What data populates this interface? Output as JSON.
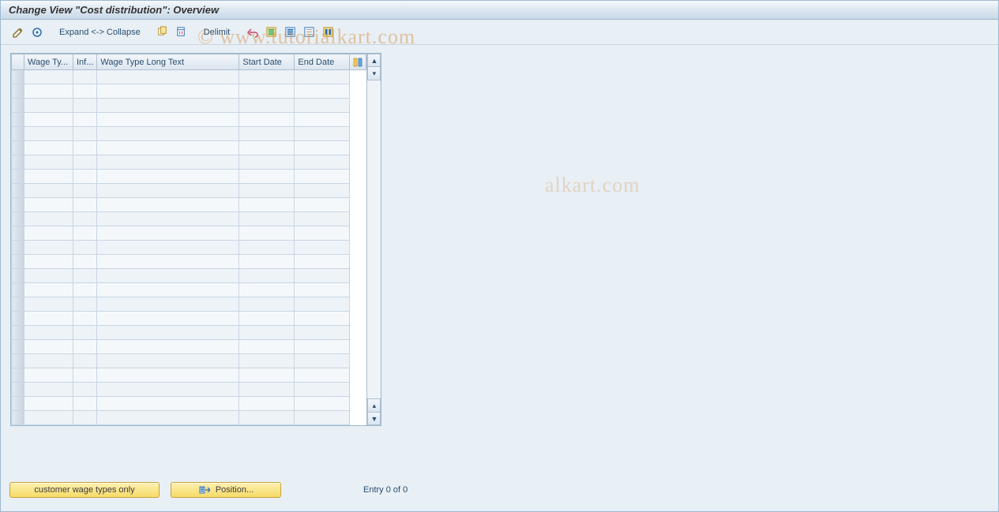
{
  "title": "Change View \"Cost distribution\": Overview",
  "toolbar": {
    "expand_collapse_label": "Expand <-> Collapse",
    "delimit_label": "Delimit"
  },
  "table": {
    "columns": {
      "wage_type": "Wage Ty...",
      "inf": "Inf...",
      "long_text": "Wage Type Long Text",
      "start_date": "Start Date",
      "end_date": "End Date"
    },
    "row_count": 25,
    "rows": []
  },
  "footer": {
    "customer_button": "customer wage types only",
    "position_button": "Position...",
    "entry_text": "Entry 0 of 0"
  },
  "watermark": {
    "part1": "© www.tutorialkart.com",
    "part2": "alkart.com"
  }
}
